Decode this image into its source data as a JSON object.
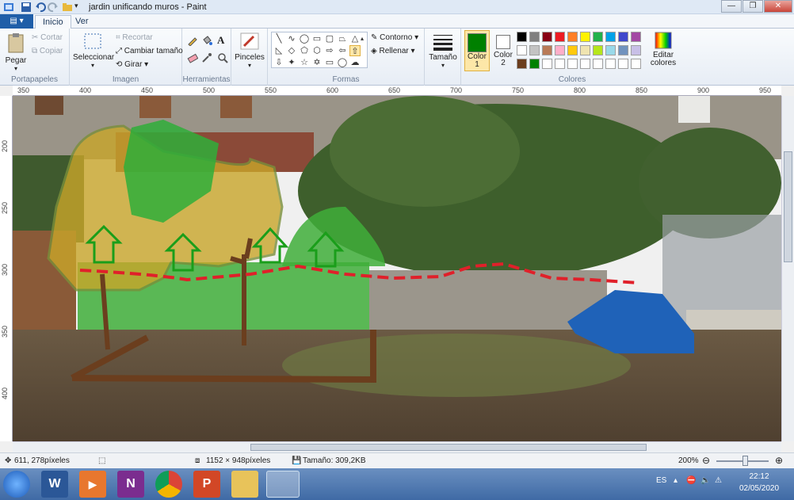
{
  "window": {
    "title": "jardin unificando muros - Paint",
    "minimize": "—",
    "maximize": "❐",
    "close": "✕"
  },
  "tabs": {
    "file": "▤ ▾",
    "items": [
      "Inicio",
      "Ver"
    ]
  },
  "ribbon": {
    "clipboard": {
      "label": "Portapapeles",
      "paste": "Pegar",
      "cut": "Cortar",
      "copy": "Copiar"
    },
    "image": {
      "label": "Imagen",
      "select": "Seleccionar",
      "crop": "Recortar",
      "resize": "Cambiar tamaño",
      "rotate": "Girar"
    },
    "tools": {
      "label": "Herramientas"
    },
    "brushes": {
      "label": "Pinceles"
    },
    "shapes": {
      "label": "Formas",
      "outline": "Contorno",
      "fill": "Rellenar"
    },
    "size": {
      "label": "Tamaño"
    },
    "colors": {
      "label": "Colores",
      "color1": "Color 1",
      "color2": "Color 2",
      "edit": "Editar colores",
      "color1_value": "#008000",
      "color2_value": "#ffffff",
      "palette_row1": [
        "#000000",
        "#7f7f7f",
        "#880015",
        "#ed1c24",
        "#ff7f27",
        "#fff200",
        "#22b14c",
        "#00a2e8",
        "#3f48cc",
        "#a349a4"
      ],
      "palette_row2": [
        "#ffffff",
        "#c3c3c3",
        "#b97a57",
        "#ffaec9",
        "#ffc90e",
        "#efe4b0",
        "#b5e61d",
        "#99d9ea",
        "#7092be",
        "#c8bfe7"
      ],
      "palette_row3": [
        "#6b3e1e",
        "#008000",
        "#ffffff",
        "#ffffff",
        "#ffffff",
        "#ffffff",
        "#ffffff",
        "#ffffff",
        "#ffffff",
        "#ffffff"
      ]
    }
  },
  "ruler": {
    "h": [
      "350",
      "400",
      "450",
      "500",
      "550",
      "600",
      "650",
      "700",
      "750",
      "800",
      "850",
      "900",
      "950"
    ],
    "v": [
      "200",
      "250",
      "300",
      "350",
      "400"
    ]
  },
  "status": {
    "cursor": "611, 278píxeles",
    "dimensions": "1152 × 948píxeles",
    "filesize": "Tamaño: 309,2KB",
    "zoom": "200%",
    "zoom_minus": "⊖",
    "zoom_plus": "⊕"
  },
  "taskbar": {
    "lang": "ES",
    "time": "22:12",
    "date": "02/05/2020"
  }
}
